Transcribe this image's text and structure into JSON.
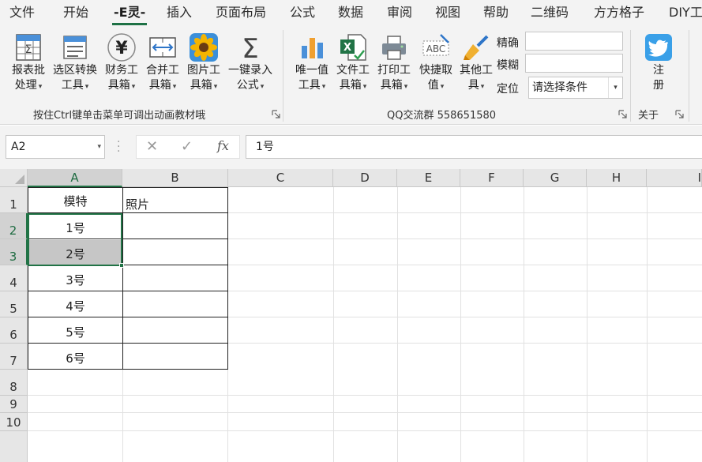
{
  "tabs": [
    "文件",
    "开始",
    "-E灵-",
    "插入",
    "页面布局",
    "公式",
    "数据",
    "审阅",
    "视图",
    "帮助",
    "二维码",
    "方方格子",
    "DIY工"
  ],
  "active_tab_index": 2,
  "ribbon": {
    "buttons": [
      {
        "line1": "报表批",
        "line2": "处理",
        "icon": "report-table-icon"
      },
      {
        "line1": "选区转换",
        "line2": "工具",
        "icon": "convert-range-icon"
      },
      {
        "line1": "财务工",
        "line2": "具箱",
        "icon": "yen-icon"
      },
      {
        "line1": "合并工",
        "line2": "具箱",
        "icon": "merge-arrows-icon"
      },
      {
        "line1": "图片工",
        "line2": "具箱",
        "icon": "sunflower-picture-icon"
      },
      {
        "line1": "一键录入",
        "line2": "公式",
        "icon": "sigma-icon"
      },
      {
        "line1": "唯一值",
        "line2": "工具",
        "icon": "bar-chart-icon"
      },
      {
        "line1": "文件工",
        "line2": "具箱",
        "icon": "excel-file-icon"
      },
      {
        "line1": "打印工",
        "line2": "具箱",
        "icon": "printer-icon"
      },
      {
        "line1": "快捷取",
        "line2": "值",
        "icon": "abc-spell-icon"
      },
      {
        "line1": "其他工",
        "line2": "具",
        "icon": "brush-icon"
      }
    ],
    "labels": {
      "exact": "精确",
      "fuzzy": "模糊",
      "locate": "定位"
    },
    "condition_select": "请选择条件",
    "register": {
      "line1": "注",
      "line2": "册",
      "icon": "twitter-bird-icon"
    },
    "groups": {
      "group1": "按住Ctrl键单击菜单可调出动画教材哦",
      "group2": "QQ交流群  558651580",
      "group3": "关于"
    }
  },
  "formula_bar": {
    "name_box": "A2",
    "cancel": "✕",
    "confirm": "✓",
    "fx": "fx",
    "value": "1号"
  },
  "columns": [
    "A",
    "B",
    "C",
    "D",
    "E",
    "F",
    "G",
    "H",
    "I"
  ],
  "rows": [
    "1",
    "2",
    "3",
    "4",
    "5",
    "6",
    "7",
    "8",
    "9",
    "10"
  ],
  "cells": {
    "A1": "模特",
    "B1": "照片",
    "A2": "1号",
    "A3": "2号",
    "A4": "3号",
    "A5": "4号",
    "A6": "5号",
    "A7": "6号"
  },
  "selection": {
    "range": "A2:A3",
    "active": "A2"
  },
  "colors": {
    "accent": "#217346",
    "selected_header": "#d2d2d2",
    "selection_shade": "#c6c6c6"
  }
}
